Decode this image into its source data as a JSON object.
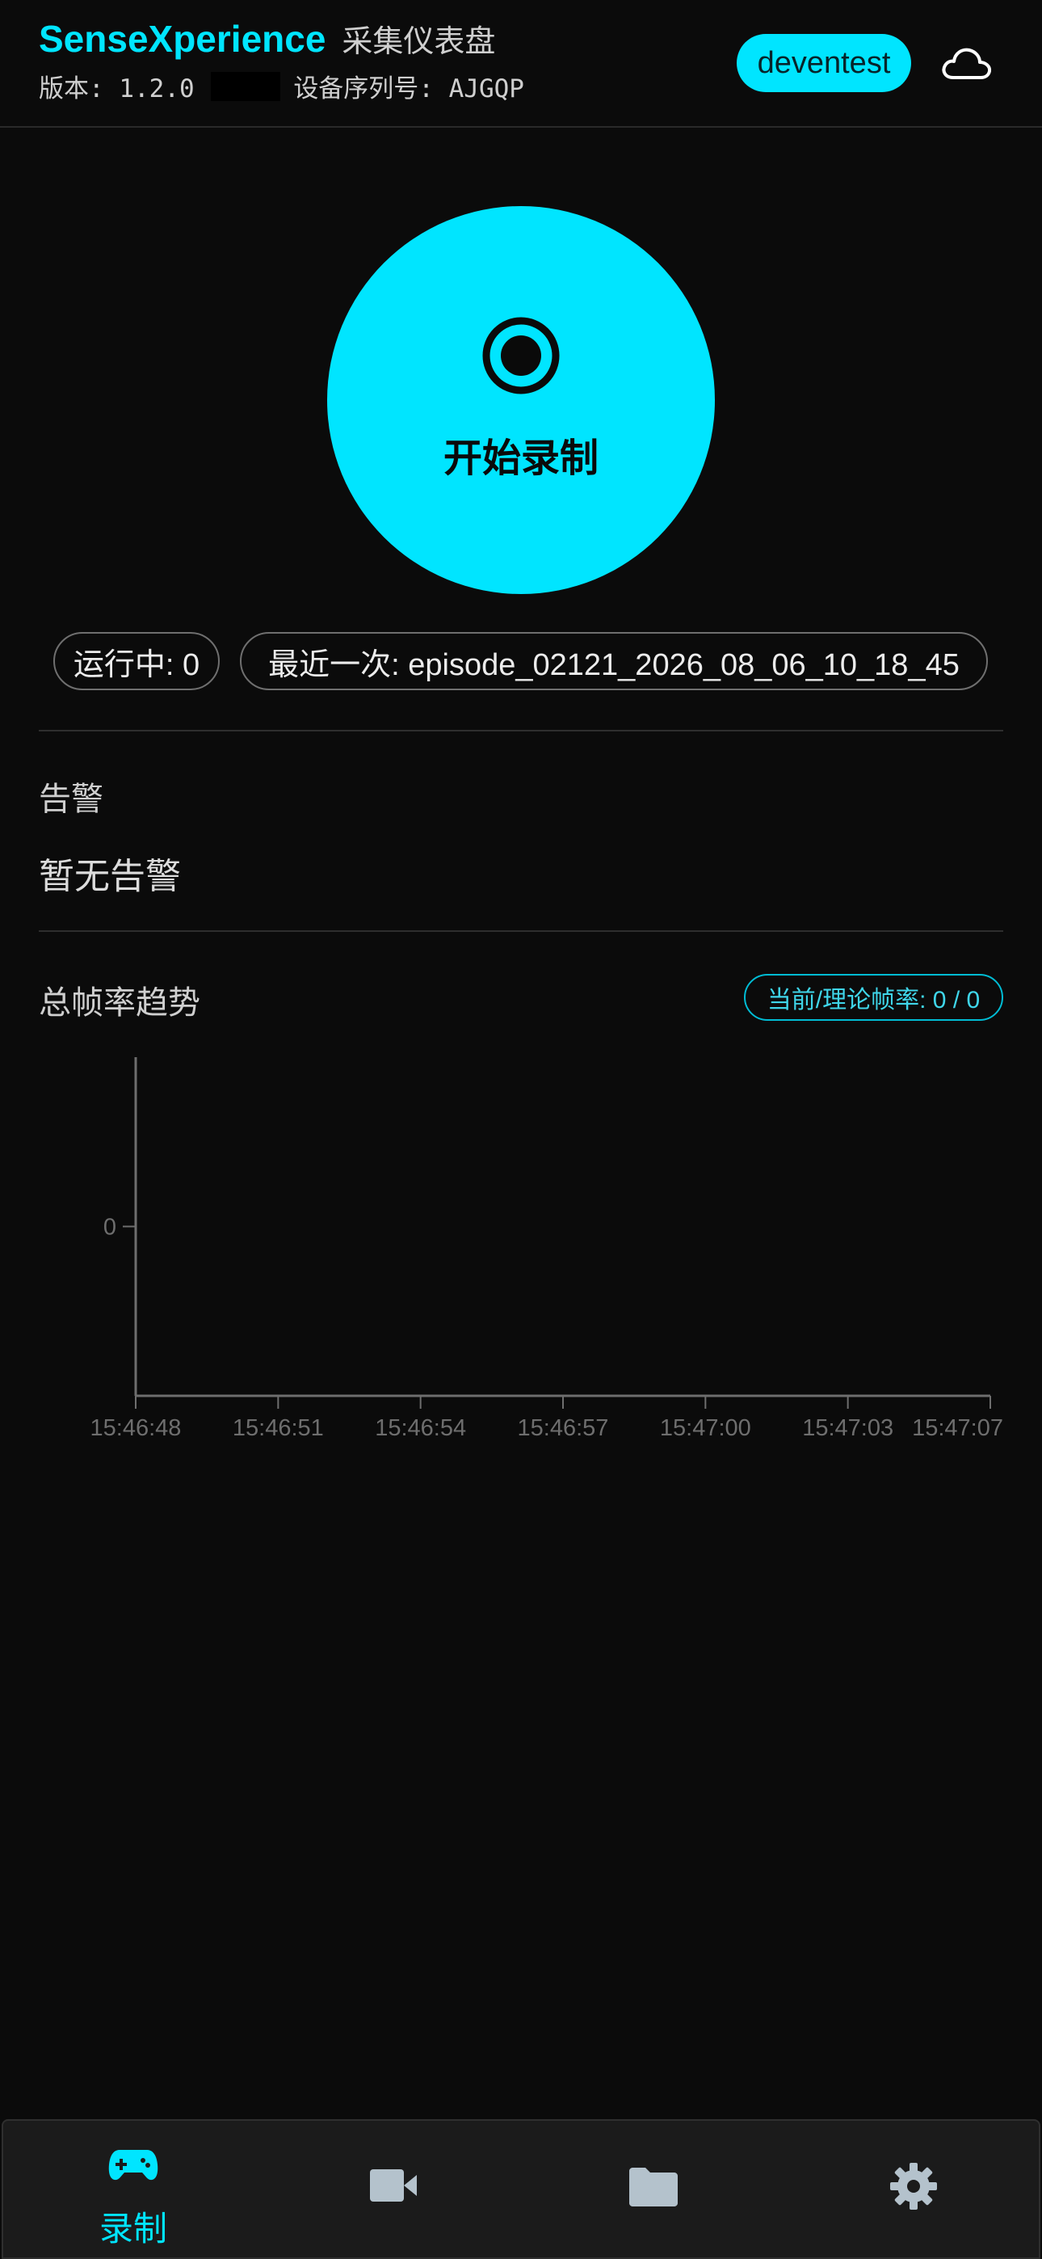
{
  "header": {
    "app_name": "SenseXperience",
    "subtitle": "采集仪表盘",
    "version_text": "版本: 1.2.0",
    "redacted_text": "0000",
    "serial_text": "设备序列号: AJGQP",
    "user_label": "deventest",
    "cloud_icon": "cloud-icon"
  },
  "record": {
    "label": "开始录制",
    "icon": "record-icon",
    "accent": "#00e5ff"
  },
  "status": {
    "running": "运行中: 0",
    "latest": "最近一次: episode_02121_2026_08_06_10_18_45"
  },
  "alerts": {
    "title": "告警",
    "empty_text": "暂无告警"
  },
  "fps": {
    "title": "总帧率趋势",
    "badge": "当前/理论帧率: 0 / 0"
  },
  "chart_data": {
    "type": "line",
    "title": "",
    "xlabel": "",
    "ylabel": "",
    "x_ticks": [
      "15:46:48",
      "15:46:51",
      "15:46:54",
      "15:46:57",
      "15:47:00",
      "15:47:03",
      "15:47:07"
    ],
    "y_ticks": [
      0
    ],
    "series": [
      {
        "values": []
      }
    ],
    "grid": false
  },
  "nav": {
    "items": [
      {
        "label": "录制",
        "icon": "gamepad-icon",
        "active": true
      },
      {
        "label": "",
        "icon": "video-camera-icon",
        "active": false
      },
      {
        "label": "",
        "icon": "folder-icon",
        "active": false
      },
      {
        "label": "",
        "icon": "gear-icon",
        "active": false
      }
    ]
  }
}
